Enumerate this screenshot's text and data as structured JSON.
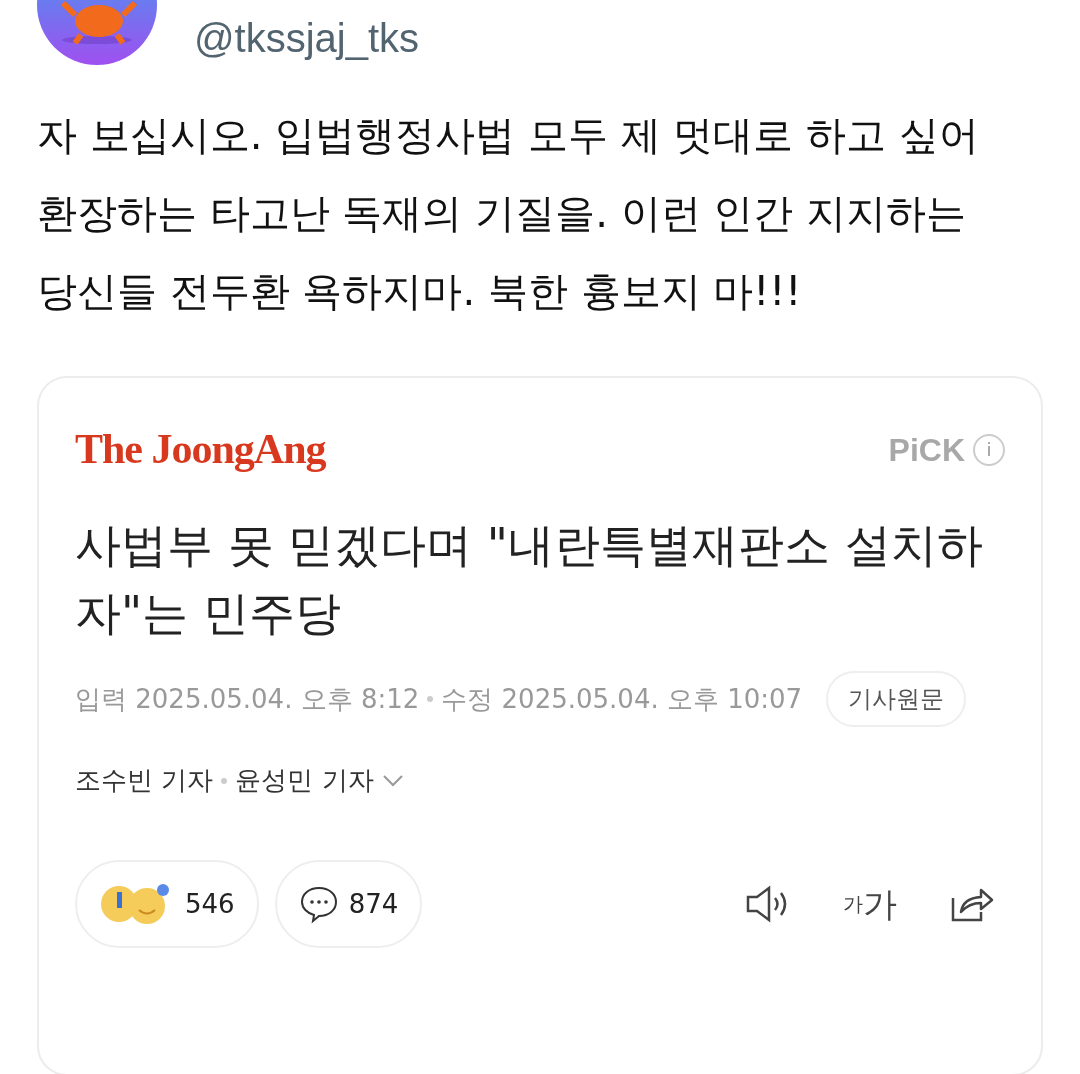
{
  "post": {
    "handle": "@tkssjaj_tks",
    "text": "자 보십시오. 입법행정사법 모두 제 멋대로 하고 싶어 환장하는 타고난 독재의 기질을. 이런 인간 지지하는 당신들 전두환 욕하지마. 북한 흉보지 마!!!"
  },
  "article": {
    "publisher": "The JoongAng",
    "badge": "PiCK",
    "info_icon": "i",
    "headline": "사법부 못 믿겠다며 \"내란특별재판소 설치하자\"는 민주당",
    "published": "입력 2025.05.04. 오후 8:12",
    "updated": "수정 2025.05.04. 오후 10:07",
    "original_button": "기사원문",
    "reporters": [
      "조수빈 기자",
      "윤성민 기자"
    ],
    "reporters_expanded": false,
    "reactions": "546",
    "comments": "874",
    "font_size_label": [
      "가",
      "가"
    ]
  }
}
